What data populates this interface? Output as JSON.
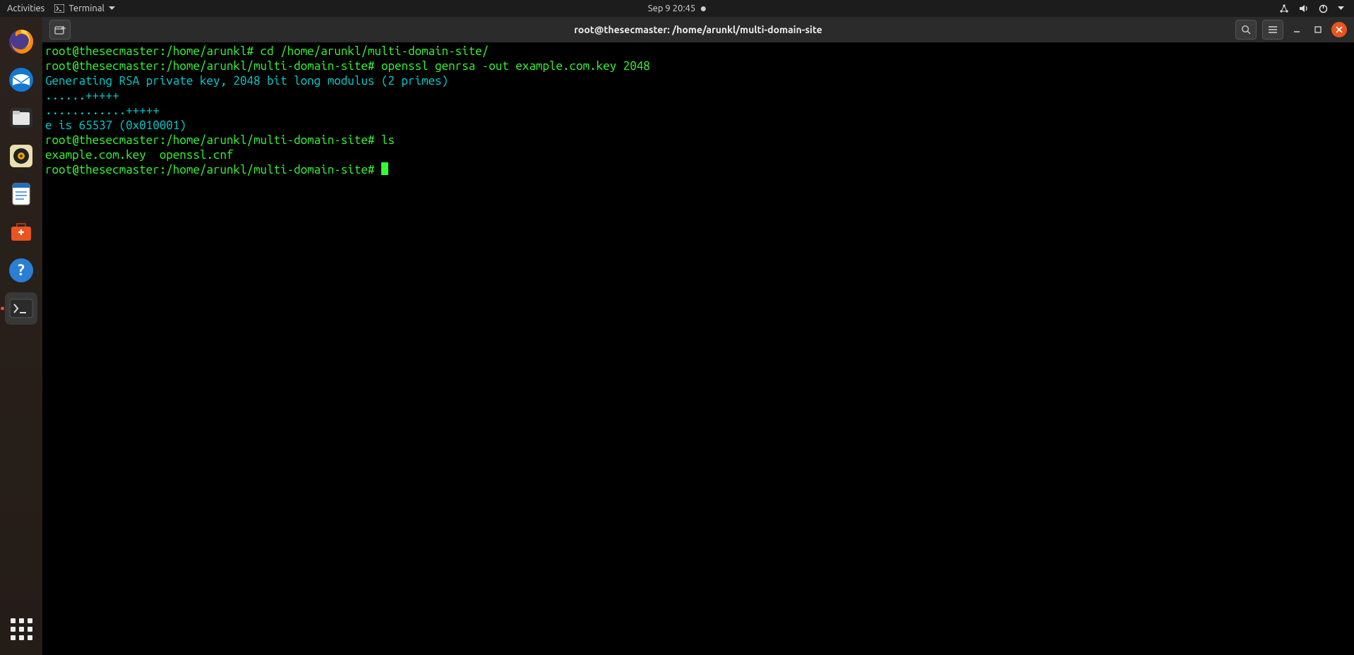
{
  "topbar": {
    "activities": "Activities",
    "app_name": "Terminal",
    "datetime": "Sep 9  20:45"
  },
  "dock": {
    "items": [
      {
        "name": "firefox"
      },
      {
        "name": "thunderbird"
      },
      {
        "name": "files"
      },
      {
        "name": "rhythmbox"
      },
      {
        "name": "writer"
      },
      {
        "name": "software"
      },
      {
        "name": "help"
      },
      {
        "name": "terminal",
        "active": true
      }
    ]
  },
  "window": {
    "title": "root@thesecmaster: /home/arunkl/multi-domain-site"
  },
  "terminal": {
    "lines": [
      {
        "t": "prompt",
        "prompt": "root@thesecmaster:/home/arunkl#",
        "cmd": " cd /home/arunkl/multi-domain-site/"
      },
      {
        "t": "prompt",
        "prompt": "root@thesecmaster:/home/arunkl/multi-domain-site#",
        "cmd": " openssl genrsa -out example.com.key 2048"
      },
      {
        "t": "out",
        "text": "Generating RSA private key, 2048 bit long modulus (2 primes)"
      },
      {
        "t": "out",
        "text": "......+++++"
      },
      {
        "t": "out",
        "text": "............+++++"
      },
      {
        "t": "out",
        "text": "e is 65537 (0x010001)"
      },
      {
        "t": "prompt",
        "prompt": "root@thesecmaster:/home/arunkl/multi-domain-site#",
        "cmd": " ls"
      },
      {
        "t": "out-green",
        "text": "example.com.key  openssl.cnf"
      },
      {
        "t": "prompt",
        "prompt": "root@thesecmaster:/home/arunkl/multi-domain-site#",
        "cmd": " ",
        "cursor": true
      }
    ]
  }
}
